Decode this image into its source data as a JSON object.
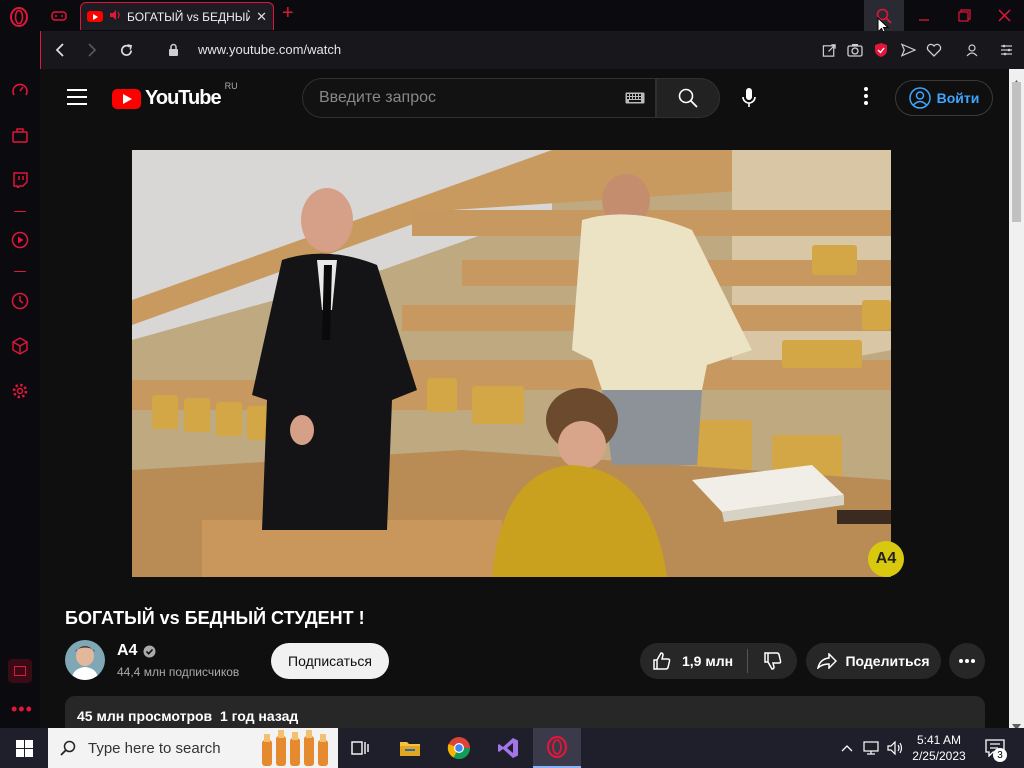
{
  "browser": {
    "tab": {
      "title": "БОГАТЫЙ vs БЕДНЫЙ СТУДЕНТ",
      "close": "✕"
    },
    "new_tab": "+",
    "url": "www.youtube.com/watch",
    "accent": "#e0163a"
  },
  "youtube": {
    "logo_text": "YouTube",
    "logo_region": "RU",
    "search_placeholder": "Введите запрос",
    "signin_label": "Войти",
    "video": {
      "title": "БОГАТЫЙ vs БЕДНЫЙ СТУДЕНТ !",
      "watermark": "A4"
    },
    "channel": {
      "name": "A4",
      "subscribers": "44,4 млн подписчиков"
    },
    "subscribe_label": "Подписаться",
    "likes": "1,9 млн",
    "share_label": "Поделиться",
    "description_meta": "45 млн просмотров  1 год назад"
  },
  "taskbar": {
    "search_placeholder": "Type here to search",
    "time": "5:41 AM",
    "date": "2/25/2023",
    "notification_count": "3"
  }
}
